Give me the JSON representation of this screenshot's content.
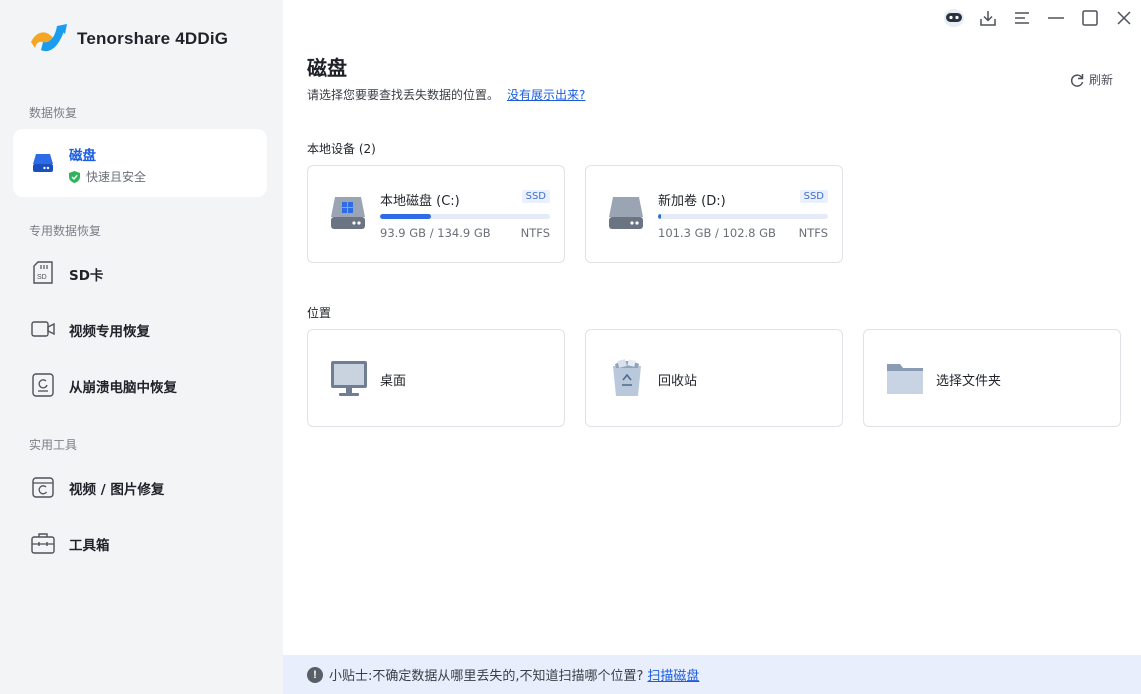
{
  "app": {
    "name": "Tenorshare 4DDiG"
  },
  "colors": {
    "accent": "#1a5ce0",
    "sidebar_bg": "#f3f4f6",
    "card_border": "#dfe2e7",
    "tip_bg": "#e8eefb",
    "safe_green": "#2fb35b"
  },
  "sidebar": {
    "sections": [
      {
        "label": "数据恢复"
      },
      {
        "label": "专用数据恢复"
      },
      {
        "label": "实用工具"
      }
    ],
    "items": [
      {
        "label": "磁盘",
        "sub": "快速且安全",
        "icon": "disk-icon",
        "active": true
      },
      {
        "label": "SD卡",
        "icon": "sd-card-icon"
      },
      {
        "label": "视频专用恢复",
        "icon": "video-camera-icon"
      },
      {
        "label": "从崩溃电脑中恢复",
        "icon": "crashed-computer-icon"
      },
      {
        "label": "视频 / 图片修复",
        "icon": "repair-icon"
      },
      {
        "label": "工具箱",
        "icon": "toolbox-icon"
      }
    ]
  },
  "window_controls": [
    "assistant-robot-icon",
    "download-icon",
    "menu-icon",
    "minimize-icon",
    "maximize-icon",
    "close-icon"
  ],
  "main": {
    "title": "磁盘",
    "subtitle": "请选择您要要查找丢失数据的位置。",
    "subtitle_link": "没有展示出来?",
    "refresh_label": "刷新",
    "devices_label": "本地设备 (2)",
    "devices": [
      {
        "name": "本地磁盘 (C:)",
        "badge": "SSD",
        "usage": "93.9 GB / 134.9 GB",
        "fs": "NTFS",
        "used_fraction": 0.3
      },
      {
        "name": "新加卷 (D:)",
        "badge": "SSD",
        "usage": "101.3 GB / 102.8 GB",
        "fs": "NTFS",
        "used_fraction": 0.015
      }
    ],
    "locations_label": "位置",
    "locations": [
      {
        "name": "桌面",
        "icon": "desktop-monitor-icon"
      },
      {
        "name": "回收站",
        "icon": "recycle-bin-icon"
      },
      {
        "name": "选择文件夹",
        "icon": "folder-icon"
      }
    ]
  },
  "tip": {
    "icon_glyph": "!",
    "text": "小贴士:不确定数据从哪里丢失的,不知道扫描哪个位置?",
    "link": "扫描磁盘"
  }
}
